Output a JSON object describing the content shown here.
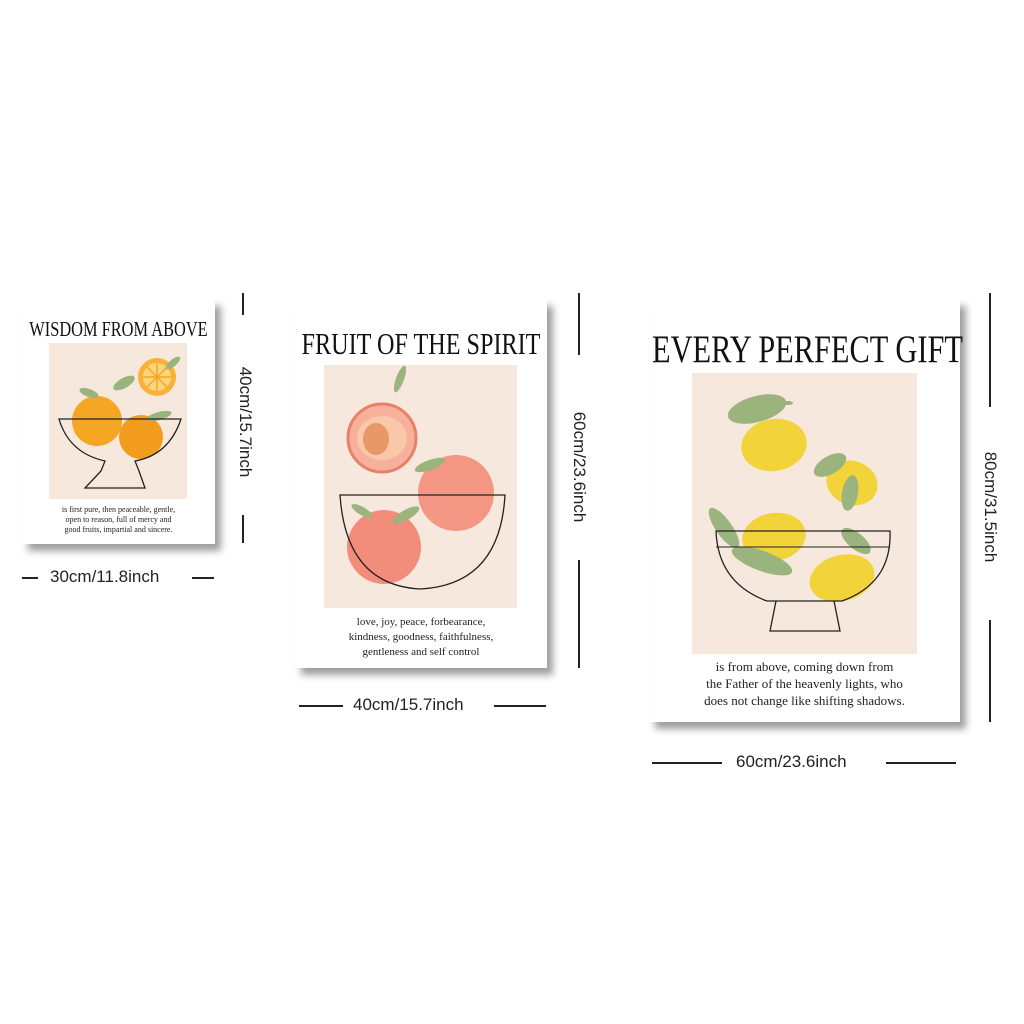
{
  "posters": [
    {
      "title": "WISDOM FROM ABOVE",
      "caption": [
        "is first pure, then peaceable, gentle,",
        "open to reason, full of mercy and",
        "good fruits, impartial and sincere."
      ],
      "width_label": "30cm/11.8inch",
      "height_label": "40cm/15.7inch",
      "fruit": "orange"
    },
    {
      "title": "FRUIT OF THE SPIRIT",
      "caption": [
        "love, joy, peace, forbearance,",
        "kindness, goodness, faithfulness,",
        "gentleness and self control"
      ],
      "width_label": "40cm/15.7inch",
      "height_label": "60cm/23.6inch",
      "fruit": "peach"
    },
    {
      "title": "EVERY PERFECT GIFT",
      "caption": [
        "is from above, coming down from",
        "the Father of the heavenly lights, who",
        "does not change like shifting shadows."
      ],
      "width_label": "60cm/23.6inch",
      "height_label": "80cm/31.5inch",
      "fruit": "lemon"
    }
  ],
  "colors": {
    "art_background": "#f6e8dc",
    "orange": "#f5a623",
    "peach": "#f0907a",
    "lemon": "#f2d43a",
    "leaf": "#9bb37c"
  }
}
